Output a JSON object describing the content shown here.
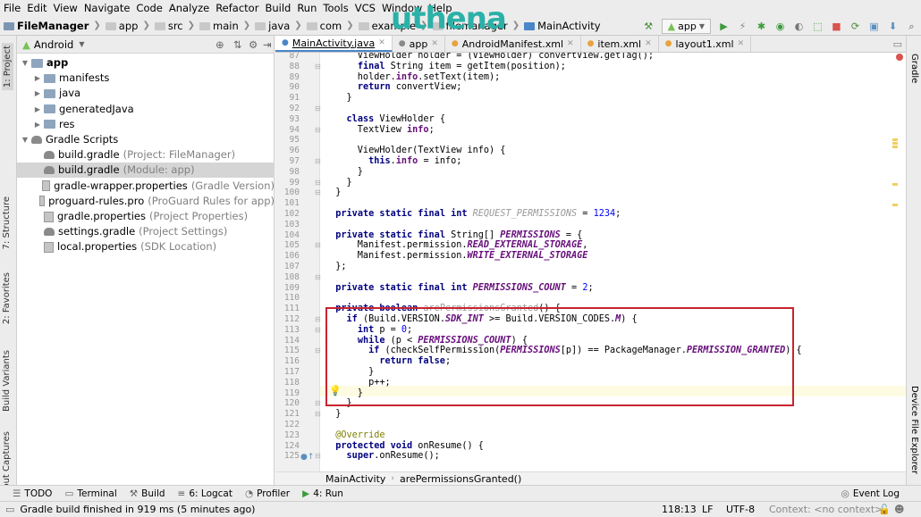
{
  "menu": [
    "File",
    "Edit",
    "View",
    "Navigate",
    "Code",
    "Analyze",
    "Refactor",
    "Build",
    "Run",
    "Tools",
    "VCS",
    "Window",
    "Help"
  ],
  "nav": {
    "project": "FileManager",
    "crumbs": [
      "app",
      "src",
      "main",
      "java",
      "com",
      "example",
      "filemanager",
      "MainActivity"
    ],
    "brand": "uthena",
    "run_config": "app"
  },
  "project_panel": {
    "view": "Android",
    "tree": [
      {
        "label": "app",
        "note": ""
      },
      {
        "label": "manifests",
        "note": ""
      },
      {
        "label": "java",
        "note": ""
      },
      {
        "label": "generatedJava",
        "note": ""
      },
      {
        "label": "res",
        "note": ""
      },
      {
        "label": "Gradle Scripts",
        "note": ""
      },
      {
        "label": "build.gradle",
        "note": "(Project: FileManager)"
      },
      {
        "label": "build.gradle",
        "note": "(Module: app)"
      },
      {
        "label": "gradle-wrapper.properties",
        "note": "(Gradle Version)"
      },
      {
        "label": "proguard-rules.pro",
        "note": "(ProGuard Rules for app)"
      },
      {
        "label": "gradle.properties",
        "note": "(Project Properties)"
      },
      {
        "label": "settings.gradle",
        "note": "(Project Settings)"
      },
      {
        "label": "local.properties",
        "note": "(SDK Location)"
      }
    ]
  },
  "left_tabs": [
    "1: Project",
    "7: Structure",
    "2: Favorites",
    "Build Variants",
    "Layout Captures"
  ],
  "right_tabs": [
    "Gradle",
    "Device File Explorer"
  ],
  "editor_tabs": [
    {
      "label": "MainActivity.java",
      "active": true
    },
    {
      "label": "app",
      "active": false
    },
    {
      "label": "AndroidManifest.xml",
      "active": false
    },
    {
      "label": "item.xml",
      "active": false
    },
    {
      "label": "layout1.xml",
      "active": false
    }
  ],
  "code_lines": [
    {
      "n": "87",
      "t": [
        [
          "      ViewHolder holder = (ViewHolder) convertView.getTag();",
          ""
        ]
      ]
    },
    {
      "n": "88",
      "t": [
        [
          "      ",
          ""
        ],
        [
          "final ",
          "kw"
        ],
        [
          "String item = getItem(position);",
          ""
        ]
      ]
    },
    {
      "n": "89",
      "t": [
        [
          "      holder.",
          ""
        ],
        [
          "info",
          "fld"
        ],
        [
          ".setText(item);",
          ""
        ]
      ]
    },
    {
      "n": "90",
      "t": [
        [
          "      ",
          ""
        ],
        [
          "return ",
          "kw"
        ],
        [
          "convertView;",
          ""
        ]
      ]
    },
    {
      "n": "91",
      "t": [
        [
          "    }",
          ""
        ]
      ]
    },
    {
      "n": "92",
      "t": [
        [
          "",
          ""
        ]
      ]
    },
    {
      "n": "93",
      "t": [
        [
          "    ",
          ""
        ],
        [
          "class ",
          "kw"
        ],
        [
          "ViewHolder {",
          ""
        ]
      ]
    },
    {
      "n": "94",
      "t": [
        [
          "      TextView ",
          ""
        ],
        [
          "info",
          "fld"
        ],
        [
          ";",
          ""
        ]
      ]
    },
    {
      "n": "95",
      "t": [
        [
          "",
          ""
        ]
      ]
    },
    {
      "n": "96",
      "t": [
        [
          "      ViewHolder(TextView info) {",
          ""
        ]
      ]
    },
    {
      "n": "97",
      "t": [
        [
          "        ",
          ""
        ],
        [
          "this",
          "kw"
        ],
        [
          ".",
          ""
        ],
        [
          "info",
          "fld"
        ],
        [
          " = info;",
          ""
        ]
      ]
    },
    {
      "n": "98",
      "t": [
        [
          "      }",
          ""
        ]
      ]
    },
    {
      "n": "99",
      "t": [
        [
          "    }",
          ""
        ]
      ]
    },
    {
      "n": "100",
      "t": [
        [
          "  }",
          ""
        ]
      ]
    },
    {
      "n": "101",
      "t": [
        [
          "",
          ""
        ]
      ]
    },
    {
      "n": "102",
      "t": [
        [
          "  ",
          ""
        ],
        [
          "private static final int ",
          "kw"
        ],
        [
          "REQUEST_PERMISSIONS",
          "unusedi"
        ],
        [
          " = ",
          ""
        ],
        [
          "1234",
          "num"
        ],
        [
          ";",
          ""
        ]
      ]
    },
    {
      "n": "103",
      "t": [
        [
          "",
          ""
        ]
      ]
    },
    {
      "n": "104",
      "t": [
        [
          "  ",
          ""
        ],
        [
          "private static final ",
          "kw"
        ],
        [
          "String[] ",
          ""
        ],
        [
          "PERMISSIONS",
          "ifld"
        ],
        [
          " = {",
          ""
        ]
      ]
    },
    {
      "n": "105",
      "t": [
        [
          "      Manifest.permission.",
          ""
        ],
        [
          "READ_EXTERNAL_STORAGE",
          "ifld"
        ],
        [
          ",",
          ""
        ]
      ]
    },
    {
      "n": "106",
      "t": [
        [
          "      Manifest.permission.",
          ""
        ],
        [
          "WRITE_EXTERNAL_STORAGE",
          "ifld"
        ]
      ]
    },
    {
      "n": "107",
      "t": [
        [
          "  };",
          ""
        ]
      ]
    },
    {
      "n": "108",
      "t": [
        [
          "",
          ""
        ]
      ]
    },
    {
      "n": "109",
      "t": [
        [
          "  ",
          ""
        ],
        [
          "private static final int ",
          "kw"
        ],
        [
          "PERMISSIONS_COUNT",
          "ifld"
        ],
        [
          " = ",
          ""
        ],
        [
          "2",
          "num"
        ],
        [
          ";",
          ""
        ]
      ]
    },
    {
      "n": "110",
      "t": [
        [
          "",
          ""
        ]
      ]
    },
    {
      "n": "111",
      "t": [
        [
          "  ",
          ""
        ],
        [
          "private boolean ",
          "kw"
        ],
        [
          "arePermissionsGranted",
          "unused"
        ],
        [
          "() {",
          ""
        ]
      ]
    },
    {
      "n": "112",
      "t": [
        [
          "    ",
          ""
        ],
        [
          "if ",
          "kw"
        ],
        [
          "(Build.VERSION.",
          ""
        ],
        [
          "SDK_INT",
          "ifld"
        ],
        [
          " >= Build.VERSION_CODES.",
          ""
        ],
        [
          "M",
          "ifld"
        ],
        [
          ") {",
          ""
        ]
      ]
    },
    {
      "n": "113",
      "t": [
        [
          "      ",
          ""
        ],
        [
          "int ",
          "kw"
        ],
        [
          "p = ",
          ""
        ],
        [
          "0",
          "num"
        ],
        [
          ";",
          ""
        ]
      ]
    },
    {
      "n": "114",
      "t": [
        [
          "      ",
          ""
        ],
        [
          "while ",
          "kw"
        ],
        [
          "(p < ",
          ""
        ],
        [
          "PERMISSIONS_COUNT",
          "ifld"
        ],
        [
          ") {",
          ""
        ]
      ]
    },
    {
      "n": "115",
      "t": [
        [
          "        ",
          ""
        ],
        [
          "if ",
          "kw"
        ],
        [
          "(checkSelfPermission(",
          ""
        ],
        [
          "PERMISSIONS",
          "ifld"
        ],
        [
          "[p]) == PackageManager.",
          ""
        ],
        [
          "PERMISSION_GRANTED",
          "ifld"
        ],
        [
          ") {",
          ""
        ]
      ]
    },
    {
      "n": "116",
      "t": [
        [
          "          ",
          ""
        ],
        [
          "return false",
          "kw"
        ],
        [
          ";",
          ""
        ]
      ]
    },
    {
      "n": "117",
      "t": [
        [
          "        }",
          ""
        ]
      ]
    },
    {
      "n": "118",
      "t": [
        [
          "        p++;",
          ""
        ]
      ]
    },
    {
      "n": "119",
      "t": [
        [
          "      }",
          ""
        ]
      ]
    },
    {
      "n": "120",
      "t": [
        [
          "    }",
          ""
        ]
      ]
    },
    {
      "n": "121",
      "t": [
        [
          "  }",
          ""
        ]
      ]
    },
    {
      "n": "122",
      "t": [
        [
          "",
          ""
        ]
      ]
    },
    {
      "n": "123",
      "t": [
        [
          "  @Override",
          "anno"
        ]
      ]
    },
    {
      "n": "124",
      "t": [
        [
          "  ",
          ""
        ],
        [
          "protected void ",
          "kw"
        ],
        [
          "onResume() {",
          ""
        ]
      ]
    },
    {
      "n": "125",
      "t": [
        [
          "    ",
          ""
        ],
        [
          "super",
          "kw"
        ],
        [
          ".onResume();",
          ""
        ]
      ]
    }
  ],
  "code_top_partial": "      }",
  "code_top_partial_n": "86",
  "editor_breadcrumb": [
    "MainActivity",
    "arePermissionsGranted()"
  ],
  "tool_windows": [
    "TODO",
    "Terminal",
    "Build",
    "6: Logcat",
    "Profiler",
    "4: Run"
  ],
  "event_log": "Event Log",
  "status": {
    "message": "Gradle build finished in 919 ms (5 minutes ago)",
    "position": "118:13",
    "line_sep": "LF",
    "encoding": "UTF-8",
    "context": "Context: <no context>"
  },
  "colors": {
    "highlight_box": "#c8242e",
    "keyword": "#000080",
    "field": "#660e7a",
    "number": "#0000ff",
    "brand_u": "#2bb1a8",
    "brand_r": "#e0533f"
  }
}
